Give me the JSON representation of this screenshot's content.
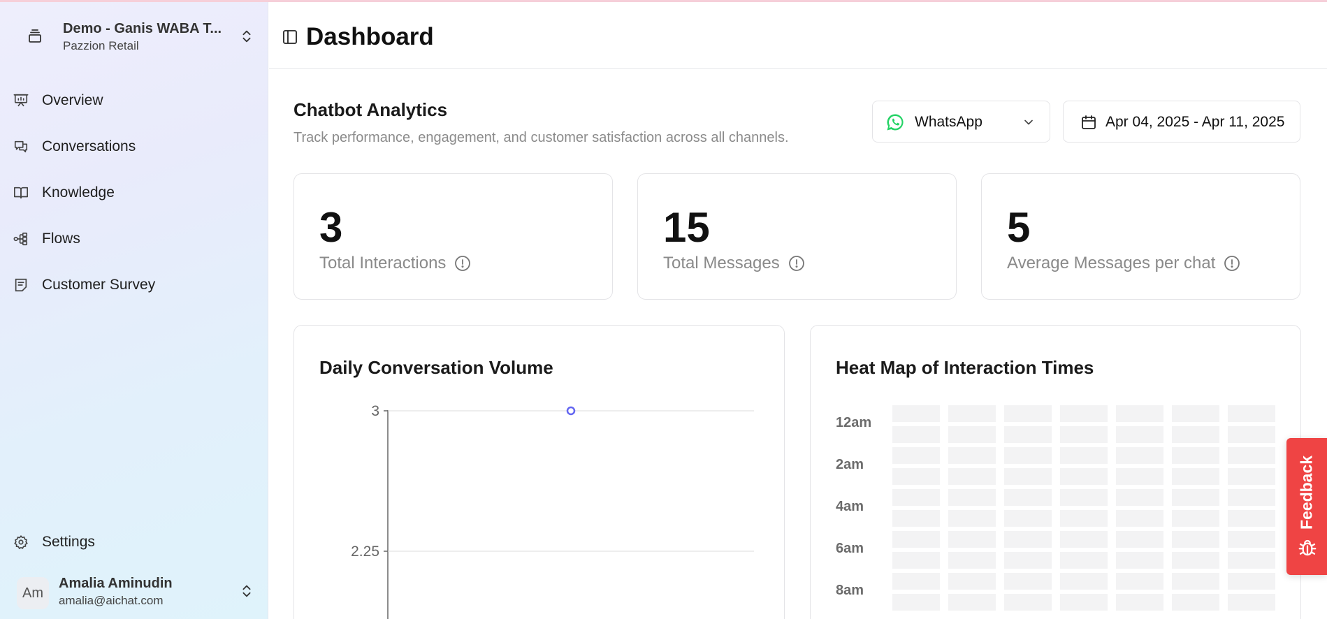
{
  "workspace": {
    "name": "Demo - Ganis WABA T...",
    "org": "Pazzion Retail"
  },
  "nav": [
    {
      "label": "Overview",
      "icon": "presentation-icon"
    },
    {
      "label": "Conversations",
      "icon": "messages-icon"
    },
    {
      "label": "Knowledge",
      "icon": "book-icon"
    },
    {
      "label": "Flows",
      "icon": "workflow-icon"
    },
    {
      "label": "Customer Survey",
      "icon": "survey-icon"
    }
  ],
  "settings": {
    "label": "Settings",
    "icon": "gear-icon"
  },
  "user": {
    "initials": "Am",
    "name": "Amalia Aminudin",
    "email": "amalia@aichat.com"
  },
  "header": {
    "title": "Dashboard"
  },
  "section": {
    "title": "Chatbot Analytics",
    "subtitle": "Track performance, engagement, and customer satisfaction across all channels."
  },
  "channel_select": {
    "value": "WhatsApp"
  },
  "date_range": {
    "value": "Apr 04, 2025 - Apr 11, 2025"
  },
  "stats": [
    {
      "value": "3",
      "label": "Total Interactions"
    },
    {
      "value": "15",
      "label": "Total Messages"
    },
    {
      "value": "5",
      "label": "Average Messages per chat"
    }
  ],
  "line_card": {
    "title": "Daily Conversation Volume"
  },
  "heatmap_card": {
    "title": "Heat Map of Interaction Times",
    "row_labels": [
      "12am",
      "2am",
      "4am",
      "6am",
      "8am"
    ]
  },
  "feedback": {
    "label": "Feedback"
  },
  "colors": {
    "accent": "#6366f1",
    "feedback": "#ef4444",
    "whatsapp": "#25d366"
  },
  "chart_data": {
    "type": "line",
    "title": "Daily Conversation Volume",
    "xlabel": "",
    "ylabel": "",
    "yticks": [
      "3",
      "2.25"
    ],
    "ylim": [
      2.25,
      3
    ],
    "series": [
      {
        "values": [
          3
        ]
      }
    ],
    "grid": true
  }
}
